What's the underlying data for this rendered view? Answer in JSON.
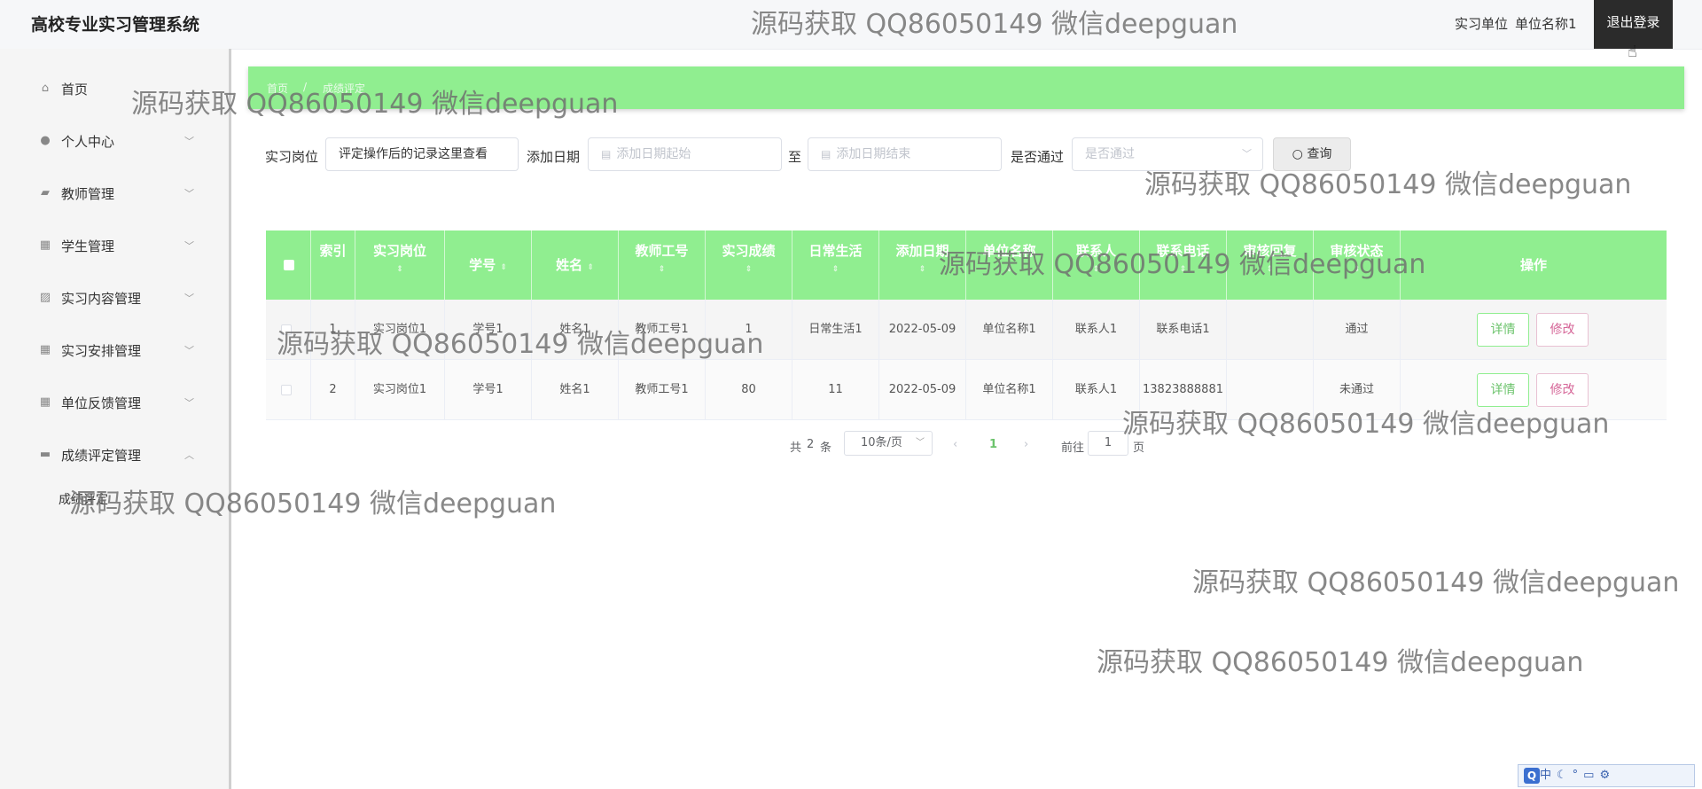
{
  "header": {
    "app_title": "高校专业实习管理系统",
    "role": "实习单位",
    "username": "单位名称1",
    "logout_label": "退出登录"
  },
  "sidebar": {
    "items": [
      {
        "label": "首页",
        "icon": "home-icon"
      },
      {
        "label": "个人中心",
        "icon": "user-icon"
      },
      {
        "label": "教师管理",
        "icon": "teacher-icon"
      },
      {
        "label": "学生管理",
        "icon": "grid-icon"
      },
      {
        "label": "实习内容管理",
        "icon": "chart-icon"
      },
      {
        "label": "实习安排管理",
        "icon": "grid-icon"
      },
      {
        "label": "单位反馈管理",
        "icon": "grid-icon"
      },
      {
        "label": "成绩评定管理",
        "icon": "message-icon"
      }
    ],
    "subitem": "成绩评定"
  },
  "breadcrumb": {
    "home": "首页",
    "separator": "/",
    "current": "成绩评定"
  },
  "filters": {
    "post_label": "实习岗位",
    "post_value": "评定操作后的记录这里查看",
    "date_label": "添加日期",
    "date_start_placeholder": "添加日期起始",
    "date_to": "至",
    "date_end_placeholder": "添加日期结束",
    "pass_label": "是否通过",
    "pass_placeholder": "是否通过",
    "search_label": "查询"
  },
  "table": {
    "headers": {
      "index": "索引",
      "post": "实习岗位",
      "student_no": "学号",
      "name": "姓名",
      "teacher_no": "教师工号",
      "score": "实习成绩",
      "daily": "日常生活",
      "date": "添加日期",
      "unit": "单位名称",
      "contact": "联系人",
      "phone": "联系电话",
      "reply": "审核回复",
      "status": "审核状态",
      "ops": "操作"
    },
    "rows": [
      {
        "index": "1",
        "post": "实习岗位1",
        "student_no": "学号1",
        "name": "姓名1",
        "teacher_no": "教师工号1",
        "score": "1",
        "daily": "日常生活1",
        "date": "2022-05-09",
        "unit": "单位名称1",
        "contact": "联系人1",
        "phone": "联系电话1",
        "reply": "",
        "status": "通过"
      },
      {
        "index": "2",
        "post": "实习岗位1",
        "student_no": "学号1",
        "name": "姓名1",
        "teacher_no": "教师工号1",
        "score": "80",
        "daily": "11",
        "date": "2022-05-09",
        "unit": "单位名称1",
        "contact": "联系人1",
        "phone": "13823888881",
        "reply": "",
        "status": "未通过"
      }
    ],
    "detail_label": "详情",
    "edit_label": "修改"
  },
  "pagination": {
    "total_prefix": "共",
    "total": "2",
    "total_suffix": "条",
    "page_size": "10条/页",
    "current_page": "1",
    "goto_label": "前往",
    "goto_value": "1",
    "page_suffix": "页"
  },
  "watermark": "源码获取 QQ86050149 微信deepguan",
  "ime": {
    "lang": "中"
  },
  "colors": {
    "accent": "#90ee90",
    "edit": "#d56597",
    "logout_bg": "#2b2b2b"
  }
}
